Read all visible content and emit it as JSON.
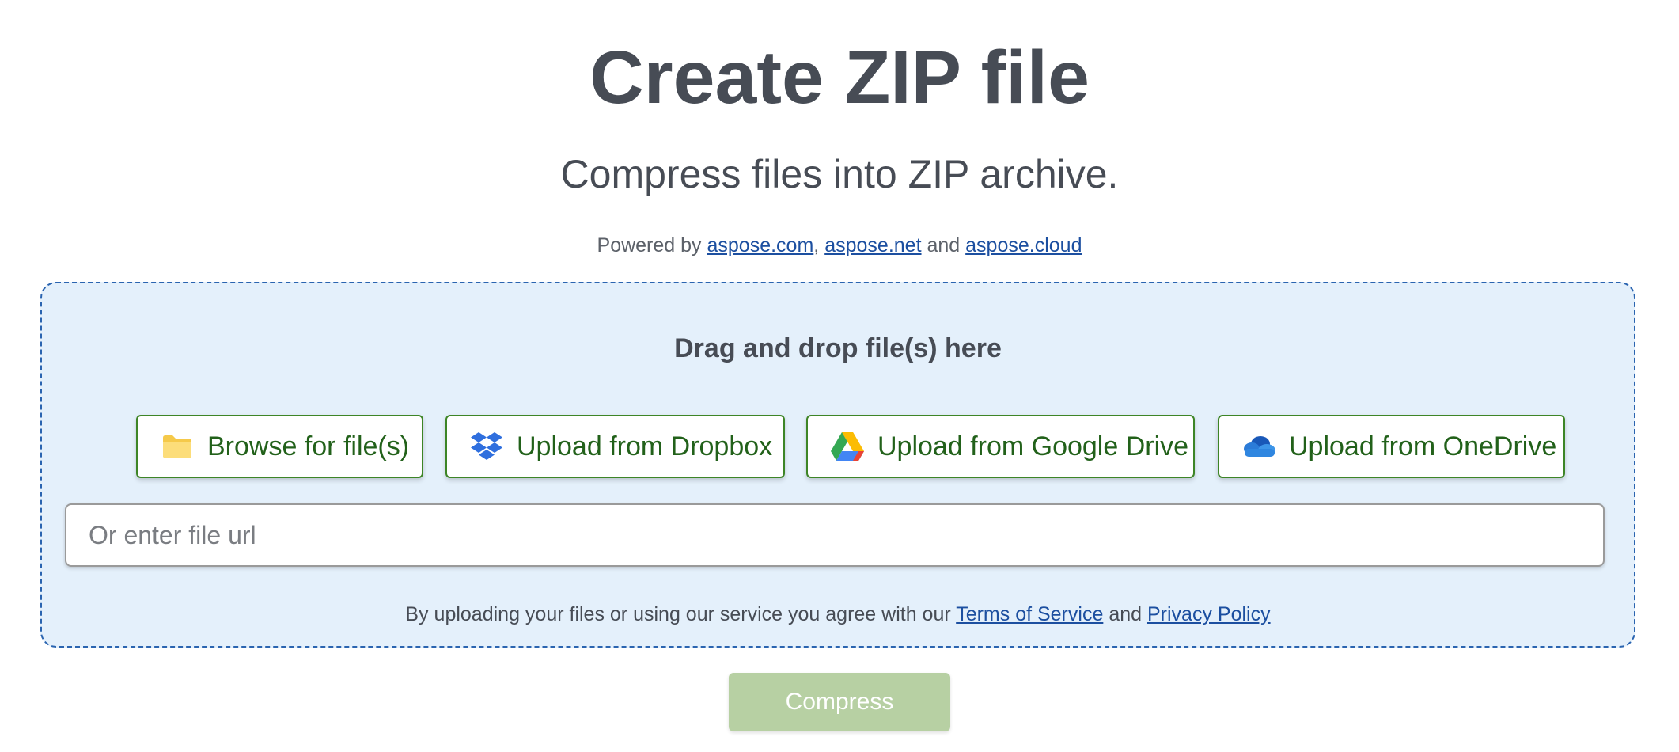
{
  "header": {
    "title": "Create ZIP file",
    "subtitle": "Compress files into ZIP archive."
  },
  "powered_by": {
    "prefix": "Powered by",
    "links": [
      "aspose.com",
      "aspose.net",
      "aspose.cloud"
    ],
    "separator": ",",
    "conjunction": "and"
  },
  "dropzone": {
    "title": "Drag and drop file(s) here",
    "buttons": [
      {
        "label": "Browse for file(s)",
        "icon": "folder-icon"
      },
      {
        "label": "Upload from Dropbox",
        "icon": "dropbox-icon"
      },
      {
        "label": "Upload from Google Drive",
        "icon": "google-drive-icon"
      },
      {
        "label": "Upload from OneDrive",
        "icon": "onedrive-icon"
      }
    ],
    "url_input": {
      "placeholder": "Or enter file url",
      "value": ""
    },
    "agreement": {
      "prefix": "By uploading your files or using our service you agree with our",
      "terms_link": "Terms of Service",
      "conjunction": "and",
      "privacy_link": "Privacy Policy"
    }
  },
  "actions": {
    "compress_label": "Compress"
  },
  "colors": {
    "text": "#474c55",
    "link": "#1c4fa0",
    "accent_green": "#3d8526",
    "dropzone_bg": "#e4f0fb",
    "dropzone_border": "#2a64b0",
    "compress_disabled_bg": "#b7d0a3"
  }
}
